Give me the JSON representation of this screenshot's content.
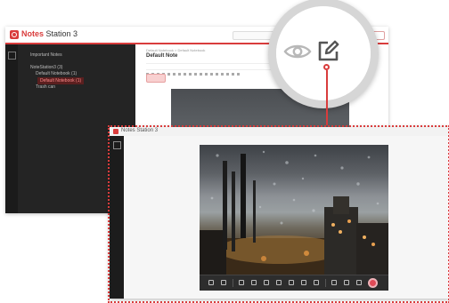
{
  "app": {
    "brand_name": "Notes",
    "brand_suffix": "Station 3",
    "sidebar": {
      "items": [
        {
          "label": "Important Notes"
        },
        {
          "label": "NoteStation3 (3)"
        },
        {
          "label": "Default Notebook (1)"
        },
        {
          "label": "Default Notebook (1)"
        },
        {
          "label": "Trash can"
        }
      ]
    },
    "editor": {
      "breadcrumb": "Default Notebook > Default Notebook",
      "note_title": "Default Note"
    }
  },
  "magnifier": {
    "icons": [
      "eye-icon",
      "edit-icon"
    ]
  },
  "preview": {
    "brand_name": "Notes",
    "brand_suffix": "Station 3",
    "toolbar_icons": [
      "select-icon",
      "crop-icon",
      "rotate-icon",
      "pen-icon",
      "highlighter-icon",
      "text-icon",
      "arrow-icon",
      "shape-icon",
      "mosaic-icon",
      "eraser-icon",
      "undo-icon",
      "redo-icon",
      "download-icon",
      "record-icon"
    ]
  },
  "colors": {
    "accent": "#d93c3c",
    "sidebar_bg": "#242424",
    "toolbar_bg": "#2d2d2d"
  }
}
